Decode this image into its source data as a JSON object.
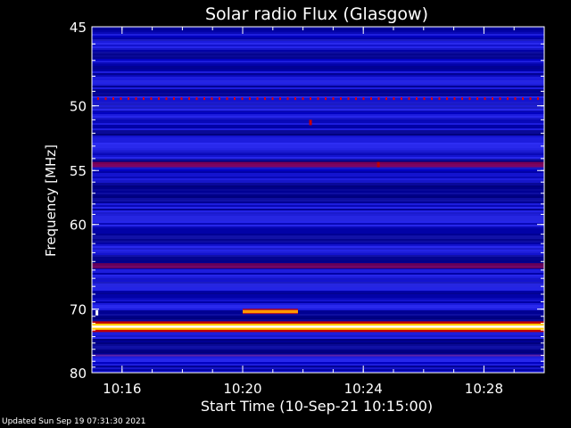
{
  "updated_text": "Updated Sun Sep 19 07:31:30 2021",
  "chart_data": {
    "type": "heatmap",
    "title": "Solar radio Flux (Glasgow)",
    "xlabel": "Start Time (10-Sep-21 10:15:00)",
    "ylabel": "Frequency [MHz]",
    "x_range": [
      "10:15:00",
      "10:30:00"
    ],
    "x_ticks": [
      "10:16",
      "10:20",
      "10:24",
      "10:28"
    ],
    "y_ticks": [
      "45",
      "50",
      "55",
      "60",
      "70",
      "80"
    ],
    "y_range": [
      45,
      80
    ],
    "y_scale": "reciprocal",
    "colormap": [
      "#00002a",
      "#0000c8",
      "#3a3aff",
      "#ff0000",
      "#ffff00",
      "#ffffff"
    ],
    "features": [
      {
        "kind": "dotted-line",
        "freq_mhz": 49.5,
        "color": "#e00000"
      },
      {
        "kind": "band",
        "freq_mhz": 54.5,
        "color": "#a0004a"
      },
      {
        "kind": "band",
        "freq_mhz": 64.5,
        "color": "#8a0040"
      },
      {
        "kind": "line",
        "freq_mhz": 72.5,
        "color": "#ffff60",
        "intensity": "max"
      },
      {
        "kind": "segment",
        "freq_mhz": 70.3,
        "start": "10:20:00",
        "end": "10:21:50",
        "color": "#ff9900"
      },
      {
        "kind": "spot",
        "freq_mhz": 51.2,
        "time": "10:22:15",
        "color": "#c80000"
      },
      {
        "kind": "spot",
        "freq_mhz": 54.5,
        "time": "10:24:30",
        "color": "#c00000"
      },
      {
        "kind": "spot",
        "freq_mhz": 70.5,
        "time": "10:15:10",
        "color": "#ffffff"
      },
      {
        "kind": "faint-line",
        "freq_mhz": 77.0,
        "color": "#7a2aa0"
      }
    ]
  }
}
